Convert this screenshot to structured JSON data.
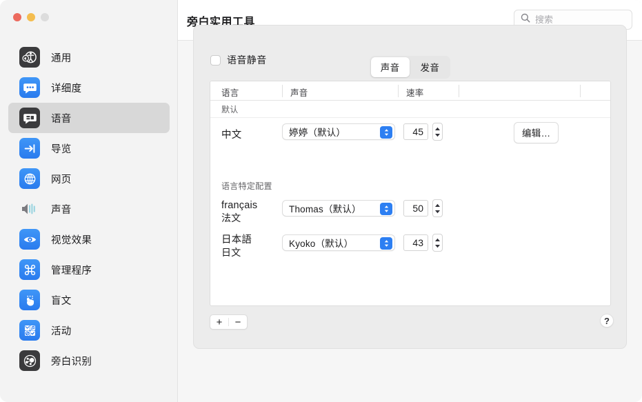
{
  "window": {
    "traffic_lights": [
      "close",
      "minimize",
      "zoom"
    ]
  },
  "header": {
    "title": "旁白实用工具",
    "search": {
      "placeholder": "搜索",
      "value": "",
      "icon": "search-icon"
    }
  },
  "sidebar": {
    "items": [
      {
        "label": "通用",
        "icon": "accessibility-icon",
        "selected": false
      },
      {
        "label": "详细度",
        "icon": "speech-bubble-icon",
        "selected": false
      },
      {
        "label": "语音",
        "icon": "speech-panel-icon",
        "selected": true
      },
      {
        "label": "导览",
        "icon": "arrow-into-bar-icon",
        "selected": false
      },
      {
        "label": "网页",
        "icon": "globe-icon",
        "selected": false
      },
      {
        "label": "声音",
        "icon": "speaker-waves-icon",
        "selected": false
      },
      {
        "label": "视觉效果",
        "icon": "eye-icon",
        "selected": false
      },
      {
        "label": "管理程序",
        "icon": "command-key-icon",
        "selected": false
      },
      {
        "label": "盲文",
        "icon": "braille-hand-icon",
        "selected": false
      },
      {
        "label": "活动",
        "icon": "activities-grid-icon",
        "selected": false
      },
      {
        "label": "旁白识别",
        "icon": "recognition-icon",
        "selected": false
      }
    ]
  },
  "main": {
    "tabs": [
      {
        "label": "声音",
        "active": true
      },
      {
        "label": "发音",
        "active": false
      }
    ],
    "mute_checkbox": {
      "label": "语音静音",
      "checked": false
    },
    "table": {
      "columns": [
        "语言",
        "声音",
        "速率",
        "",
        ""
      ],
      "groups": [
        {
          "title": "默认",
          "rows": [
            {
              "language_main": "中文",
              "language_sub": "",
              "voice": "婷婷（默认）",
              "rate": "45",
              "action_label": "编辑…",
              "has_action": true
            }
          ]
        },
        {
          "title": "语言特定配置",
          "rows": [
            {
              "language_main": "français",
              "language_sub": "法文",
              "voice": "Thomas（默认）",
              "rate": "50",
              "action_label": "",
              "has_action": false
            },
            {
              "language_main": "日本語",
              "language_sub": "日文",
              "voice": "Kyoko（默认）",
              "rate": "43",
              "action_label": "",
              "has_action": false
            }
          ]
        }
      ]
    },
    "footer": {
      "add_label": "+",
      "remove_label": "−",
      "help_label": "?"
    }
  },
  "colors": {
    "accent": "#2d7ff2",
    "window_bg": "#f6f6f6",
    "sidebar_bg": "#f3f3f3",
    "panel_bg": "#ececec",
    "selected_row": "#d8d8d8",
    "table_bg": "#ffffff",
    "traffic_red": "#ec6a5e",
    "traffic_yellow": "#f4bd4f",
    "traffic_gray": "#dcdcdc"
  }
}
